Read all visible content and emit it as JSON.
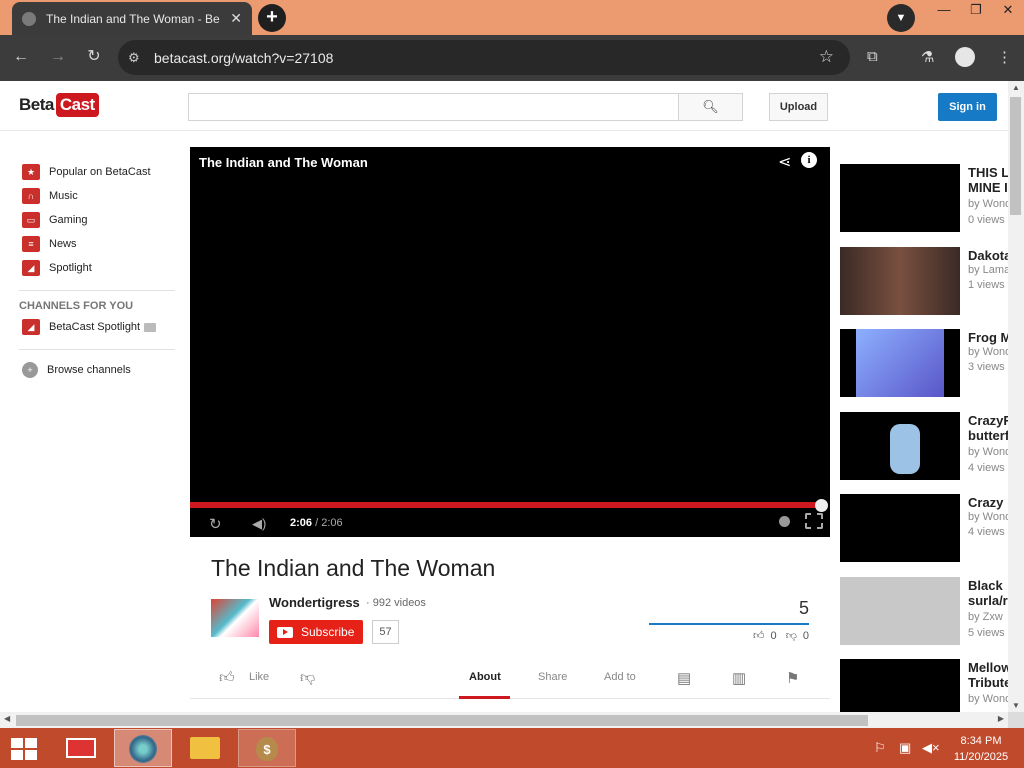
{
  "browser": {
    "tab_title": "The Indian and The Woman - Be",
    "tab_close": "✕",
    "new_tab": "+",
    "url": "betacast.org/watch?v=27108",
    "window_controls": [
      "—",
      "❐",
      "✕"
    ]
  },
  "site": {
    "logo_beta": "Beta",
    "logo_cast": "Cast",
    "search_placeholder": "",
    "upload_label": "Upload",
    "signin_label": "Sign in"
  },
  "guide": {
    "items": [
      {
        "label": "Popular on BetaCast",
        "icon": "star-icon"
      },
      {
        "label": "Music",
        "icon": "headphones-icon"
      },
      {
        "label": "Gaming",
        "icon": "gamepad-icon"
      },
      {
        "label": "News",
        "icon": "newspaper-icon"
      },
      {
        "label": "Spotlight",
        "icon": "spotlight-icon"
      }
    ],
    "channels_heading": "CHANNELS FOR YOU",
    "channel": "BetaCast Spotlight",
    "browse": "Browse channels"
  },
  "player": {
    "title": "The Indian and The Woman",
    "time_current": "2:06",
    "time_total": "/ 2:06",
    "progress": 1.0
  },
  "video": {
    "title": "The Indian and The Woman",
    "owner": "Wondertigress",
    "video_count": "· 992 videos",
    "subscribe_label": "Subscribe",
    "subscriber_count": "57",
    "views": "5",
    "likes": "0",
    "dislikes": "0"
  },
  "actions": {
    "like": "Like",
    "about": "About",
    "share": "Share",
    "add_to": "Add to"
  },
  "related": [
    {
      "title": "THIS LITTLE",
      "title2": "MINE I",
      "by": "by Wond",
      "views": "0 views",
      "thumb": "#000000"
    },
    {
      "title": "Dakota",
      "title2": "",
      "by": "by Lama",
      "views": "1 views",
      "thumb": "#5a3a30"
    },
    {
      "title": "Frog M",
      "title2": "",
      "by": "by Wond",
      "views": "3 views",
      "thumb": "#6f7fd8"
    },
    {
      "title": "CrazyF",
      "title2": "butterf",
      "by": "by Wond",
      "views": "4 views",
      "thumb": "#000000"
    },
    {
      "title": "Crazy",
      "title2": "",
      "by": "by Wond",
      "views": "4 views",
      "thumb": "#000000"
    },
    {
      "title": "Black",
      "title2": "surla/r",
      "by": "by Zxw",
      "views": "5 views",
      "thumb": "#c8c8c8"
    },
    {
      "title": "Mellow",
      "title2": "Tribute",
      "by": "by Wond",
      "views": "",
      "thumb": "#000000"
    }
  ],
  "taskbar": {
    "time": "8:34 PM",
    "date": "11/20/2025"
  }
}
